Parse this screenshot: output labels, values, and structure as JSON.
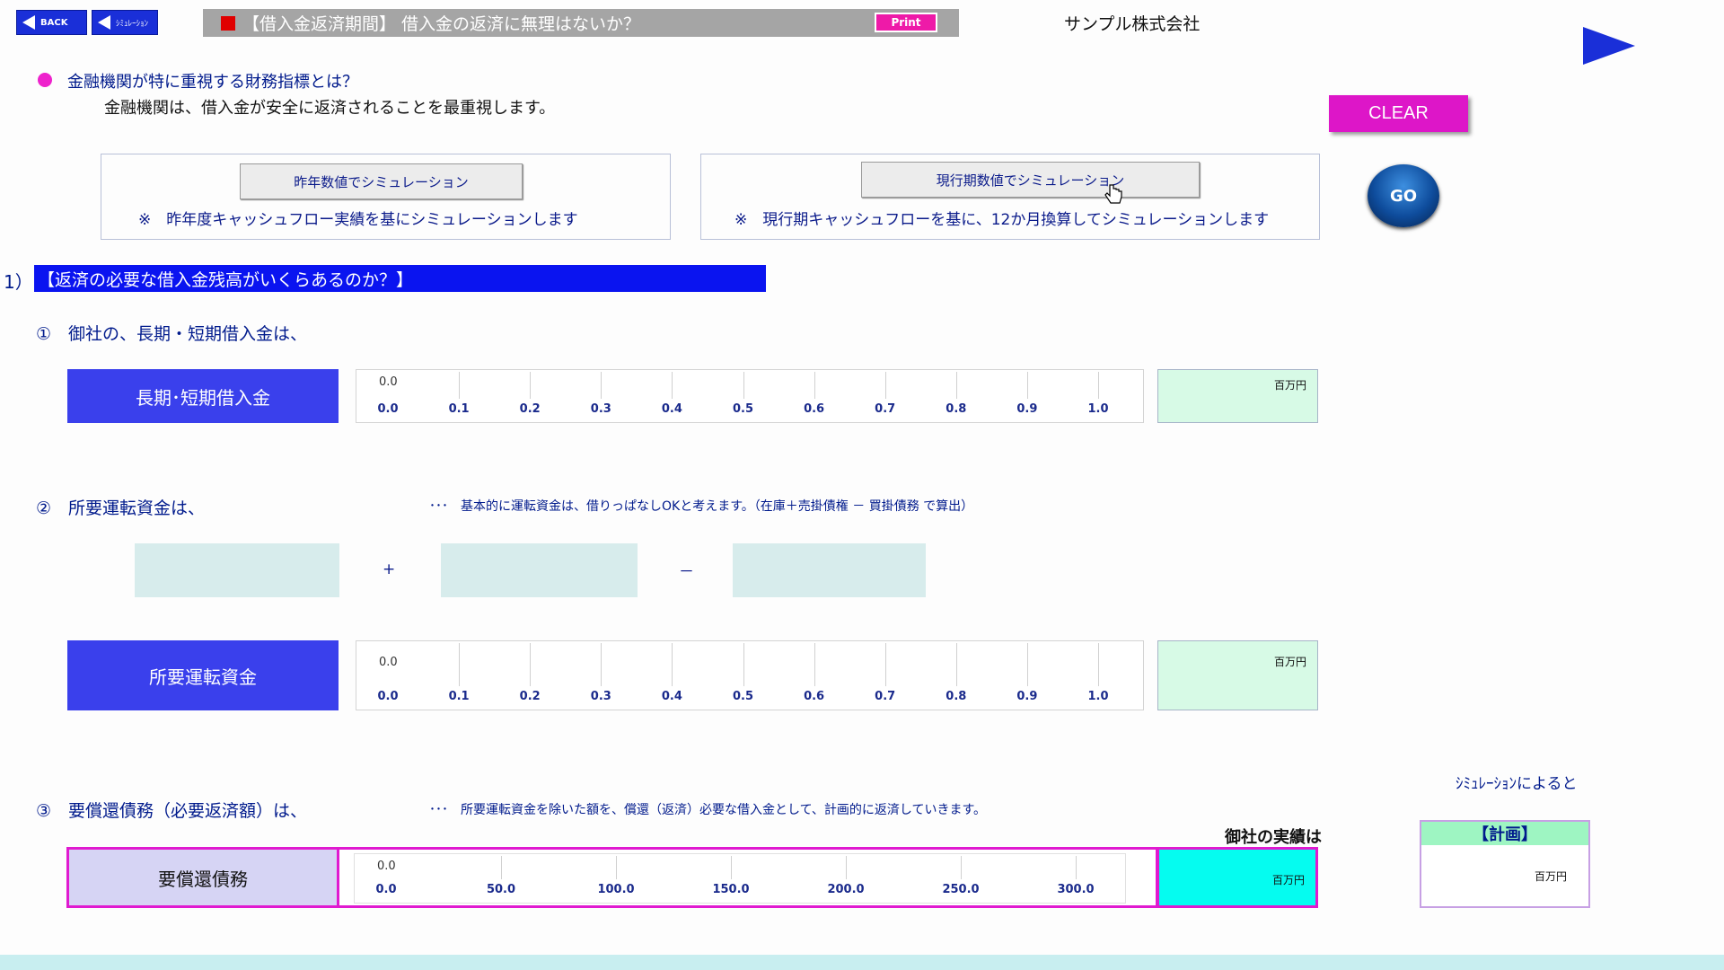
{
  "nav": {
    "back_label": "BACK",
    "sim_label": "ｼﾐｭﾚｰｼｮﾝ"
  },
  "header": {
    "title": "【借入金返済期間】 借入金の返済に無理はないか？",
    "print_label": "Print",
    "company": "サンプル株式会社"
  },
  "intro": {
    "question": "金融機関が特に重視する財務指標とは？",
    "answer": "金融機関は、借入金が安全に返済されることを最重視します。"
  },
  "controls": {
    "clear_label": "CLEAR",
    "go_label": "GO"
  },
  "simulation": {
    "last_year_button": "昨年数値でシミュレーション",
    "last_year_note": "※　昨年度キャッシュフロー実績を基にシミュレーションします",
    "current_button": "現行期数値でシミュレーション",
    "current_note": "※　現行期キャッシュフローを基に、12か月換算してシミュレーションします"
  },
  "section1": {
    "number": "1）",
    "title": "【返済の必要な借入金残高がいくらあるのか？】"
  },
  "item1": {
    "heading": "①　御社の、長期・短期借入金は、",
    "label": "長期･短期借入金",
    "value": "0.0",
    "unit": "百万円",
    "ticks": [
      "0.0",
      "0.1",
      "0.2",
      "0.3",
      "0.4",
      "0.5",
      "0.6",
      "0.7",
      "0.8",
      "0.9",
      "1.0"
    ]
  },
  "item2": {
    "heading": "②　所要運転資金は、",
    "note": "･･･　基本的に運転資金は、借りっぱなしOKと考えます。（在庫＋売掛債権 － 買掛債務 で算出）",
    "plus": "+",
    "minus": "－",
    "label": "所要運転資金",
    "value": "0.0",
    "unit": "百万円",
    "ticks": [
      "0.0",
      "0.1",
      "0.2",
      "0.3",
      "0.4",
      "0.5",
      "0.6",
      "0.7",
      "0.8",
      "0.9",
      "1.0"
    ]
  },
  "item3": {
    "heading": "③　要償還債務（必要返済額）は、",
    "note": "･･･　所要運転資金を除いた額を、償還（返済）必要な借入金として、計画的に返済していきます。",
    "label": "要償還債務",
    "value": "0.0",
    "unit": "百万円",
    "ticks": [
      "0.0",
      "50.0",
      "100.0",
      "150.0",
      "200.0",
      "250.0",
      "300.0"
    ],
    "actual_label": "御社の実績は",
    "sim_caption": "ｼﾐｭﾚｰｼｮﾝによると",
    "plan_header": "【計画】",
    "plan_unit": "百万円"
  }
}
